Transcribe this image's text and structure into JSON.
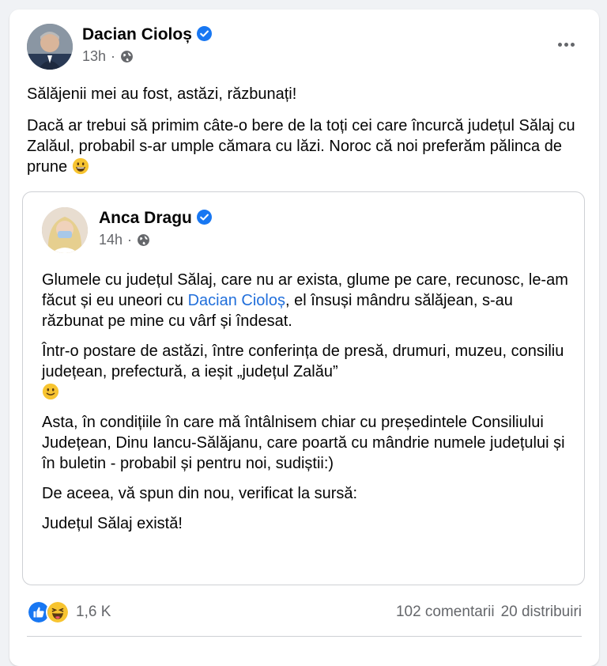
{
  "post": {
    "author": "Dacian Cioloș",
    "time": "13h",
    "separator": "·",
    "paragraphs": [
      "Sălăjenii mei au fost, astăzi, răzbunați!",
      "Dacă ar trebui să primim câte-o bere de la toți cei care încurcă județul Sălaj cu Zalăul, probabil s-ar umple cămara cu lăzi. Noroc că noi preferăm pălinca de prune"
    ]
  },
  "shared_post": {
    "author": "Anca Dragu",
    "time": "14h",
    "separator": "·",
    "p1_before": "Glumele cu județul Sălaj, care nu ar exista, glume pe care, recunosc, le-am făcut și eu uneori cu ",
    "p1_mention": "Dacian Cioloș",
    "p1_after": ", el însuși mândru sălăjean, s-au răzbunat pe mine cu vârf și îndesat.",
    "p2": "Într-o postare de astăzi, între conferința de presă, drumuri, muzeu, consiliu județean, prefectură, a ieșit „județul Zalău”",
    "p3": "Asta, în condițiile în care mă întâlnisem chiar cu președintele Consiliului Județean, Dinu Iancu-Sălăjanu, care poartă cu mândrie numele județului și în buletin - probabil și pentru noi, sudiștii:)",
    "p4": "De aceea, vă spun din nou, verificat la sursă:",
    "p5": "Județul Sălaj există!"
  },
  "footer": {
    "reaction_count": "1,6 K",
    "comments": "102 comentarii",
    "shares": "20 distribuiri"
  },
  "icons": {
    "verified": "verified-badge-icon",
    "audience": "globe-icon",
    "more": "more-options-icon",
    "reactions": [
      "like-reaction-icon",
      "haha-reaction-icon"
    ]
  },
  "colors": {
    "verified": "#1877f2",
    "mention": "#216fdb",
    "secondary_text": "#65676b",
    "border": "#ced0d4"
  }
}
